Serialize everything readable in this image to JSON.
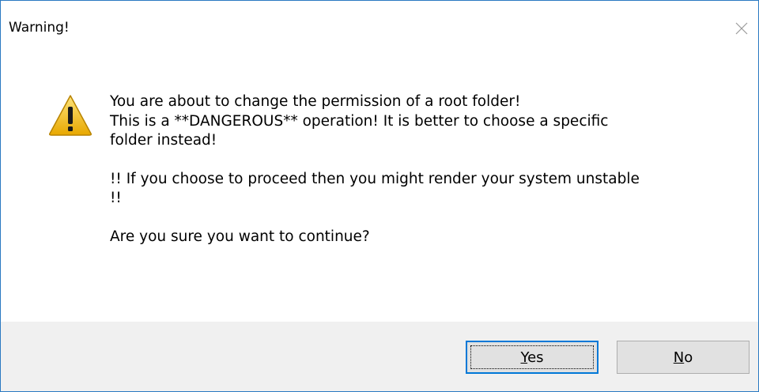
{
  "window": {
    "title": "Warning!"
  },
  "icons": {
    "warning": "warning-triangle-icon",
    "close": "close-icon"
  },
  "message": {
    "line1": "You are about to change the permission of a root folder!",
    "line2": "This is a **DANGEROUS** operation! It is better to choose a specific",
    "line3": "folder instead!",
    "line4": "!! If you choose to proceed then you might render your system unstable",
    "line5": "!!",
    "line6": "Are you sure you want to continue?"
  },
  "buttons": {
    "yes_mnemonic": "Y",
    "yes_rest": "es",
    "no_mnemonic": "N",
    "no_rest": "o"
  },
  "colors": {
    "window_border": "#2b79c2",
    "footer_bg": "#f0f0f0",
    "button_bg": "#e1e1e1",
    "focus_border": "#0078d7",
    "warning_yellow": "#f5c400"
  }
}
